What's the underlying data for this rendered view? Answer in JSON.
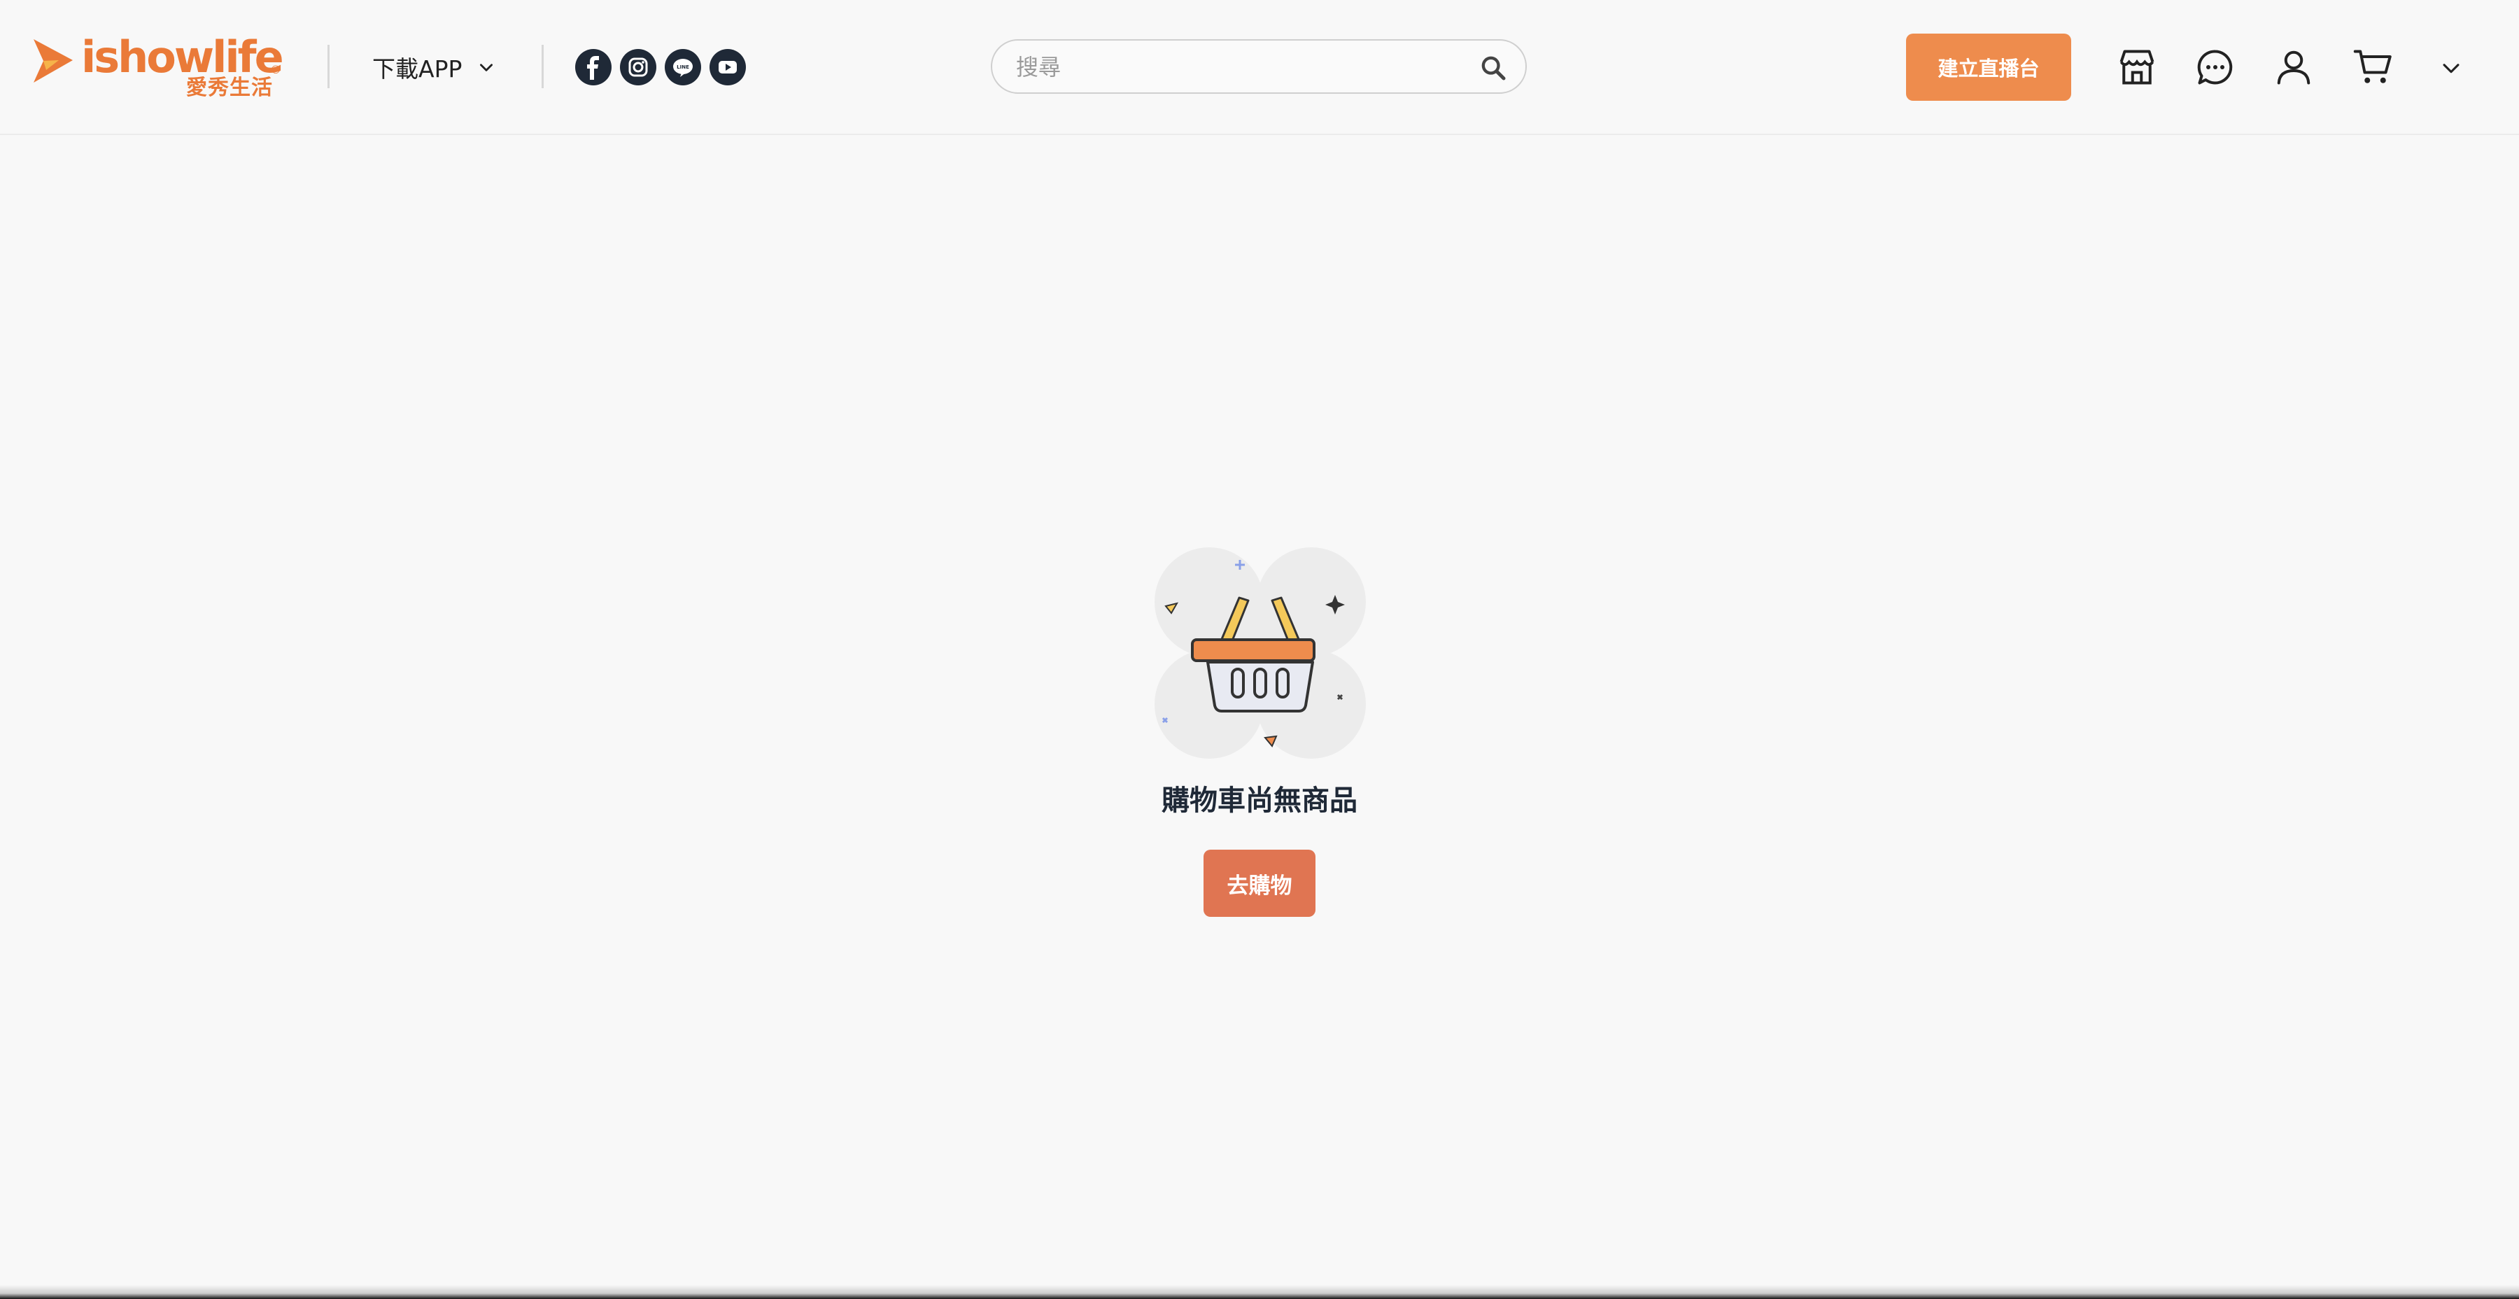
{
  "brand": {
    "wordmark": "ishowlife",
    "chinese_name": "愛秀生活",
    "registered_mark": "®",
    "color": "#ea7a38"
  },
  "header": {
    "download_label": "下載APP",
    "download_icon": "chevron-down-icon",
    "social_links": [
      "facebook-icon",
      "instagram-icon",
      "line-icon",
      "youtube-icon"
    ],
    "search": {
      "placeholder": "搜尋",
      "value": "",
      "icon": "search-icon"
    },
    "create_live_label": "建立直播台",
    "create_live_color": "#ee8c4d",
    "nav_icons": [
      "store-icon",
      "chat-icon",
      "user-icon",
      "cart-icon",
      "chevron-down-icon"
    ]
  },
  "cart": {
    "empty_message": "購物車尚無商品",
    "go_shopping_label": "去購物",
    "go_shopping_color": "#e07552",
    "illustration_icon": "empty-basket-icon"
  }
}
